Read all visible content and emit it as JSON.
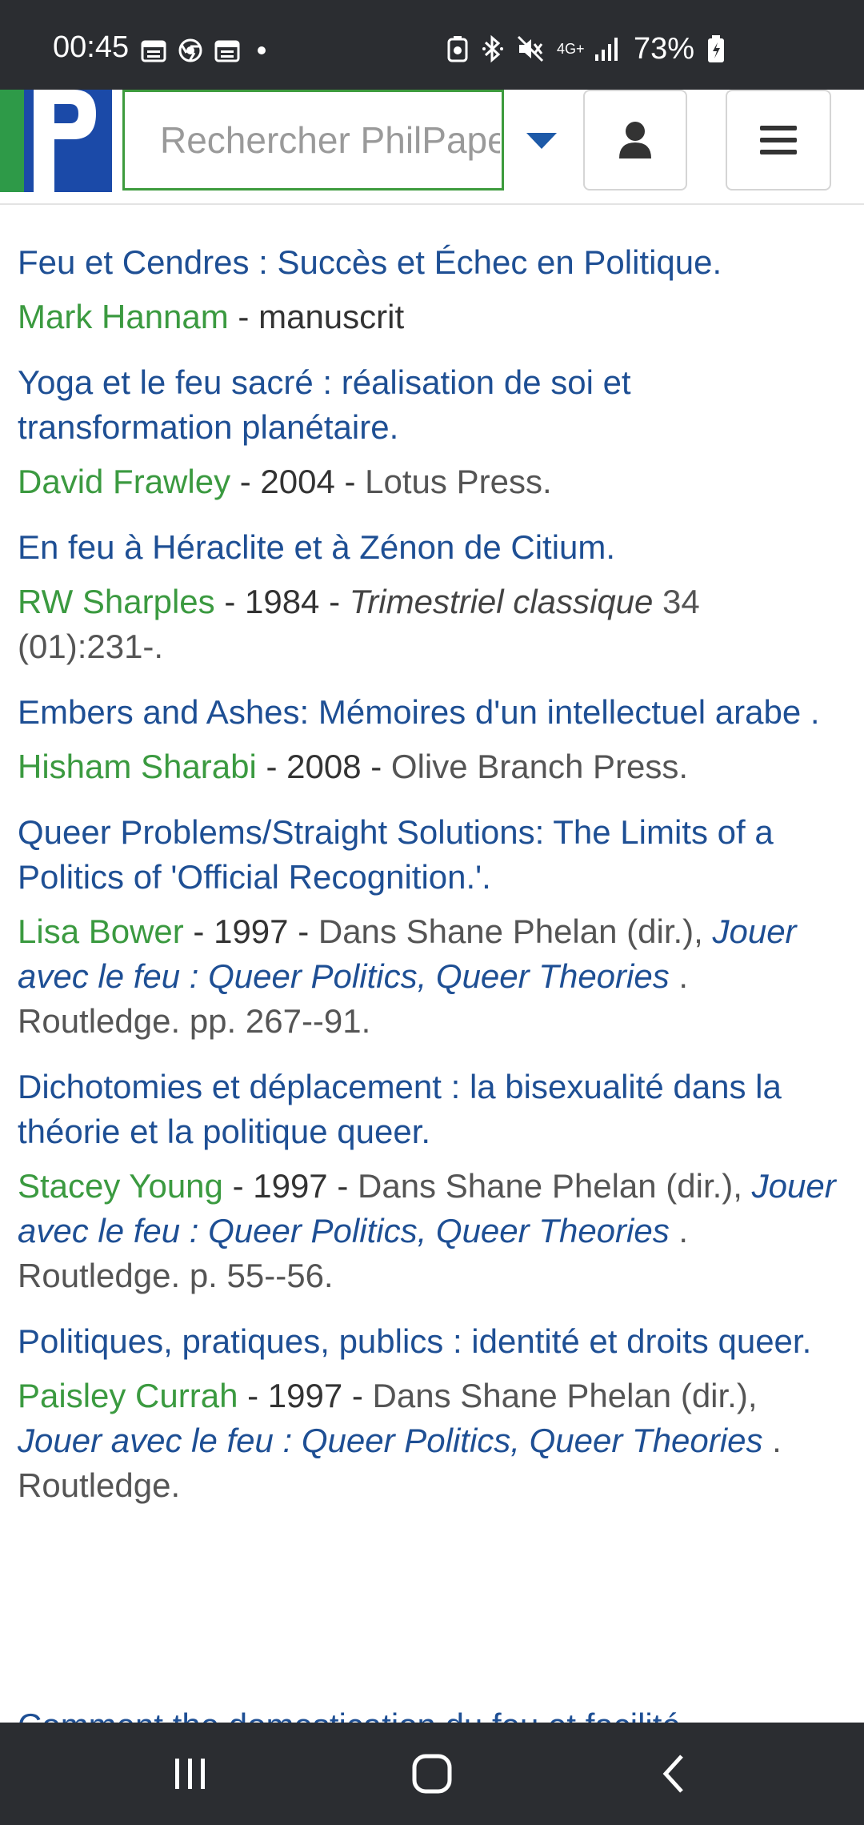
{
  "status_bar": {
    "time": "00:45",
    "network": "4G+",
    "battery": "73%",
    "icons": [
      "calendar-icon",
      "chrome-icon",
      "calendar-icon",
      "notification-dot",
      "battery-saver-icon",
      "bluetooth-icon",
      "mute-icon",
      "signal-icon",
      "battery-charging-icon"
    ]
  },
  "header": {
    "search_placeholder": "Rechercher PhilPapers",
    "logo_colors": [
      "#2e9a48",
      "#1b4aa8"
    ]
  },
  "results": [
    {
      "title": "Feu et Cendres : Succès et Échec en Politique.",
      "author": "Mark Hannam",
      "separator": " - ",
      "details": "manuscrit"
    },
    {
      "title": "Yoga et le feu sacré : réalisation de soi et transformation planétaire.",
      "author": "David Frawley",
      "separator": " - ",
      "year": "2004",
      "separator2": " - ",
      "publisher": "Lotus Press."
    },
    {
      "title": "En feu à Héraclite et à Zénon de Citium.",
      "author": "RW Sharples",
      "separator": " - ",
      "year": "1984",
      "separator2": " - ",
      "journal": "Trimestriel classique",
      "citation": " 34 (01):231-."
    },
    {
      "title": "Embers and Ashes: Mémoires d'un intellectuel arabe .",
      "author": "Hisham Sharabi",
      "separator": " - ",
      "year": "2008",
      "separator2": " - ",
      "publisher": "Olive Branch Press."
    },
    {
      "title": "Queer Problems/Straight Solutions: The Limits of a Politics of 'Official Recognition.'.",
      "author": "Lisa Bower",
      "separator": " - ",
      "year": "1997",
      "separator2": " - ",
      "in_text": "Dans Shane Phelan (dir.), ",
      "book": "Jouer avec le feu : Queer Politics, Queer Theories",
      "after_book": " . Routledge. pp. 267--91."
    },
    {
      "title": "Dichotomies et déplacement : la bisexualité dans la théorie et la politique queer.",
      "author": "Stacey Young",
      "separator": " - ",
      "year": "1997",
      "separator2": " - ",
      "in_text": "Dans Shane Phelan (dir.), ",
      "book": "Jouer avec le feu : Queer Politics, Queer Theories",
      "after_book": " . Routledge. p. 55--56."
    },
    {
      "title": "Politiques, pratiques, publics : identité et droits queer.",
      "author": "Paisley Currah",
      "separator": " - ",
      "year": "1997",
      "separator2": " - ",
      "in_text": "Dans Shane Phelan (dir.), ",
      "book": "Jouer avec le feu : Queer Politics, Queer Theories",
      "after_book": " . Routledge."
    }
  ],
  "partial_next_title": "Comment the domestication du feu et facilité"
}
